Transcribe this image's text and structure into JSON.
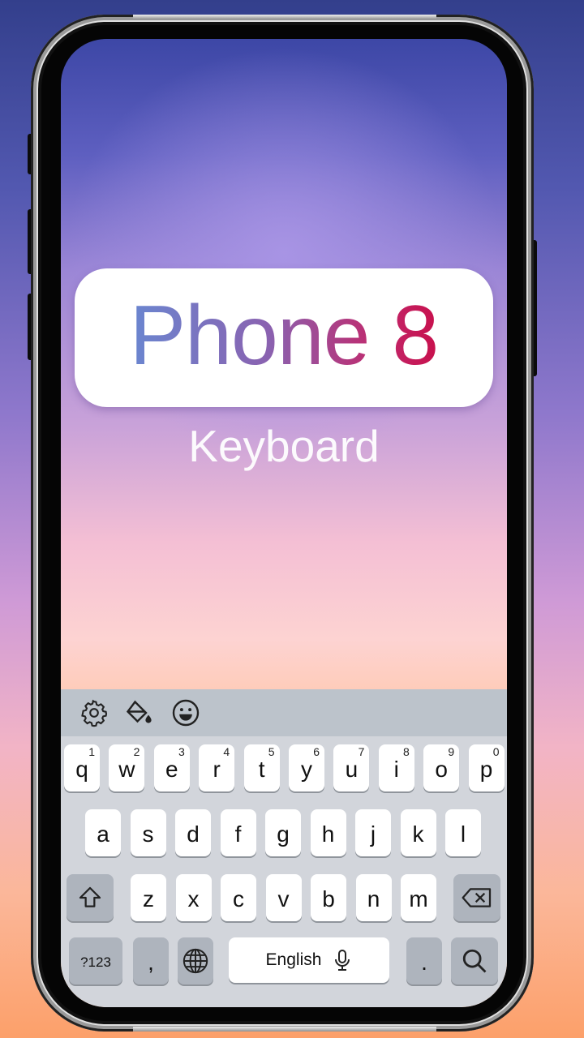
{
  "banner": {
    "title": "Phone 8",
    "subtitle": "Keyboard"
  },
  "toolbar": {
    "icons": [
      "gear-icon",
      "paint-bucket-icon",
      "emoji-icon"
    ]
  },
  "keyboard": {
    "row1": [
      {
        "key": "q",
        "hint": "1"
      },
      {
        "key": "w",
        "hint": "2"
      },
      {
        "key": "e",
        "hint": "3"
      },
      {
        "key": "r",
        "hint": "4"
      },
      {
        "key": "t",
        "hint": "5"
      },
      {
        "key": "y",
        "hint": "6"
      },
      {
        "key": "u",
        "hint": "7"
      },
      {
        "key": "i",
        "hint": "8"
      },
      {
        "key": "o",
        "hint": "9"
      },
      {
        "key": "p",
        "hint": "0"
      }
    ],
    "row2": [
      "a",
      "s",
      "d",
      "f",
      "g",
      "h",
      "j",
      "k",
      "l"
    ],
    "row3": [
      "z",
      "x",
      "c",
      "v",
      "b",
      "n",
      "m"
    ],
    "symbols_label": "?123",
    "comma_label": ",",
    "space_label": "English",
    "period_label": "."
  },
  "colors": {
    "title_gradient_start": "#6a86d0",
    "title_gradient_end": "#c8104c",
    "keyboard_bg": "#d2d5db",
    "toolbar_bg": "#bcc3cb",
    "function_key": "#aeb4bd"
  }
}
